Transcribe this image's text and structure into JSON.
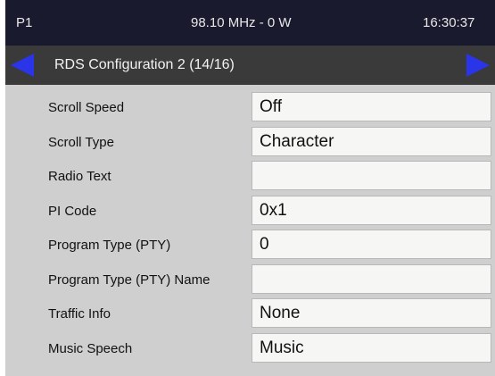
{
  "status": {
    "preset": "P1",
    "frequency": "98.10 MHz - 0 W",
    "clock": "16:30:37"
  },
  "header": {
    "title": "RDS Configuration 2 (14/16)"
  },
  "settings": [
    {
      "label": "Scroll Speed",
      "value": "Off"
    },
    {
      "label": "Scroll Type",
      "value": "Character"
    },
    {
      "label": "Radio Text",
      "value": ""
    },
    {
      "label": "PI Code",
      "value": "0x1"
    },
    {
      "label": "Program Type (PTY)",
      "value": "0"
    },
    {
      "label": "Program Type (PTY) Name",
      "value": ""
    },
    {
      "label": "Traffic Info",
      "value": "None"
    },
    {
      "label": "Music Speech",
      "value": "Music"
    }
  ],
  "colors": {
    "accent": "#2a34e8",
    "status_bg": "#1a1a2e",
    "title_bg": "#3a3a3a",
    "body_bg": "#cfcfcf"
  }
}
